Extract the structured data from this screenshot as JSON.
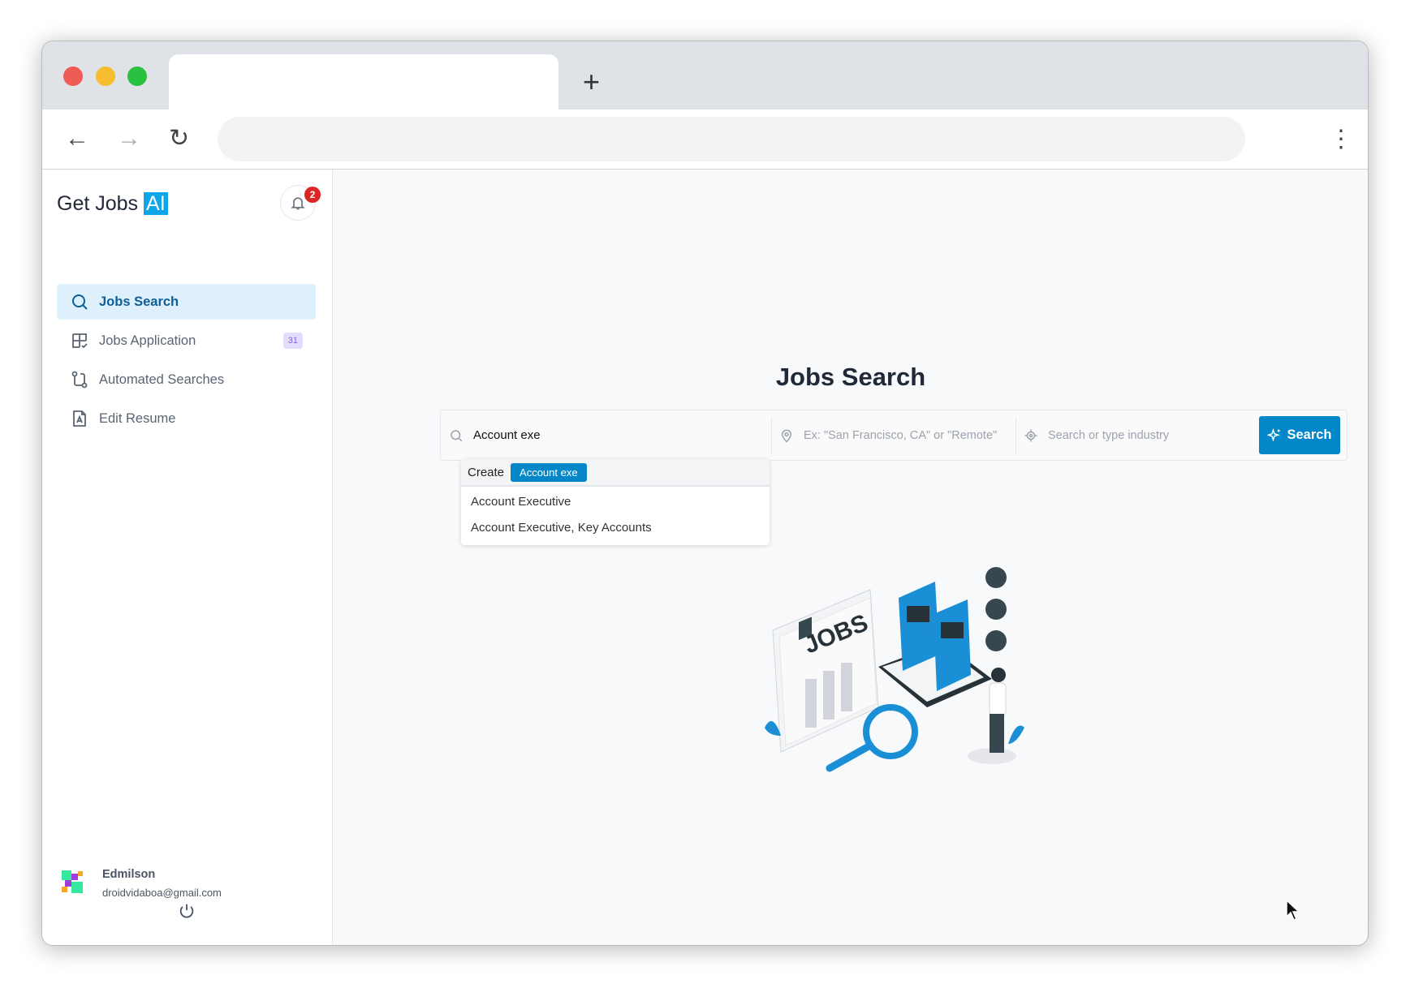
{
  "browser": {
    "new_tab_label": "+",
    "colors": {
      "close": "#ee5c55",
      "minimize": "#f7bd30",
      "maximize": "#29c140"
    }
  },
  "sidebar": {
    "logo": {
      "text": "Get Jobs",
      "highlight": "AI"
    },
    "notifications": {
      "count": "2"
    },
    "items": [
      {
        "label": "Jobs Search",
        "icon": "search-icon",
        "active": true
      },
      {
        "label": "Jobs Application",
        "icon": "grid-check-icon",
        "badge": "31"
      },
      {
        "label": "Automated Searches",
        "icon": "workflow-icon"
      },
      {
        "label": "Edit Resume",
        "icon": "resume-icon"
      }
    ],
    "user": {
      "name": "Edmilson",
      "email": "droidvidaboa@gmail.com"
    }
  },
  "main": {
    "title": "Jobs Search",
    "search": {
      "query": "Account exe",
      "location_placeholder": "Ex: \"San Francisco, CA\" or \"Remote\"",
      "industry_placeholder": "Search or type industry",
      "button_label": "Search"
    },
    "dropdown": {
      "create_label": "Create",
      "create_value": "Account exe",
      "options": [
        "Account Executive",
        "Account Executive, Key Accounts"
      ]
    },
    "illustration": {
      "sign_text": "JOBS"
    }
  },
  "colors": {
    "accent": "#0487c8",
    "active_bg": "#dff0fd",
    "badge": "#dc2626"
  }
}
